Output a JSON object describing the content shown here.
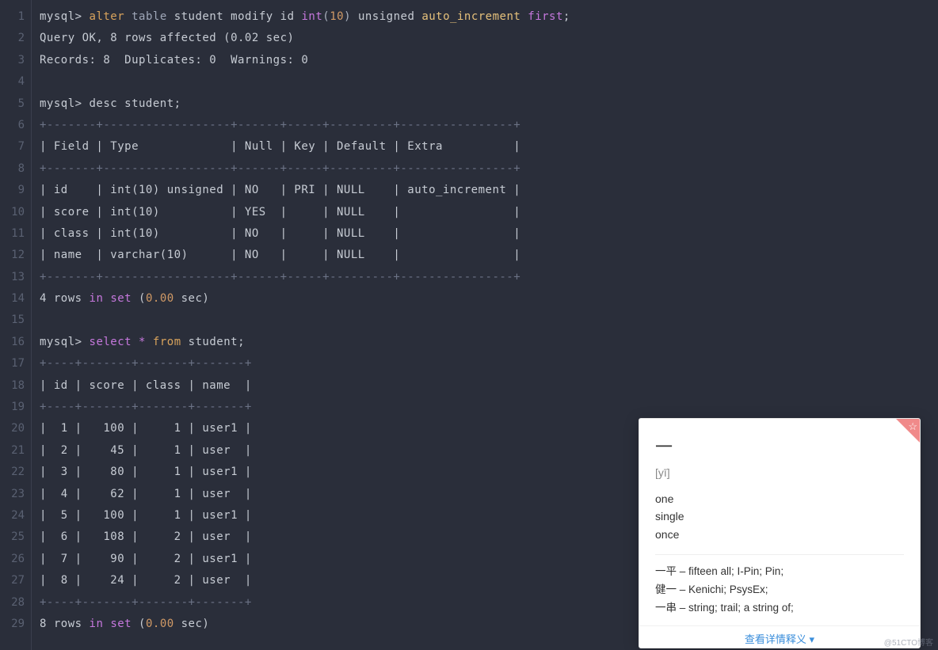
{
  "gutter": [
    "1",
    "2",
    "3",
    "4",
    "5",
    "6",
    "7",
    "8",
    "9",
    "10",
    "11",
    "12",
    "13",
    "14",
    "15",
    "16",
    "17",
    "18",
    "19",
    "20",
    "21",
    "22",
    "23",
    "24",
    "25",
    "26",
    "27",
    "28",
    "29"
  ],
  "sql": {
    "alter_prompt": "mysql> ",
    "alter_kw": "alter",
    "table_kw": "table",
    "student": "student",
    "modify": "modify",
    "id": "id",
    "int": "int",
    "ten": "10",
    "unsigned": "unsigned",
    "auto_inc": "auto_increment",
    "first": "first",
    "semi": ";",
    "query_ok": "Query OK, 8 rows affected (0.02 sec)",
    "records": "Records: 8  Duplicates: 0  Warnings: 0",
    "desc_prompt": "mysql> desc student;",
    "desc_border": "+-------+------------------+------+-----+---------+----------------+",
    "desc_header": "| Field | Type             | Null | Key | Default | Extra          |",
    "desc_rows": [
      "| id    | int(10) unsigned | NO   | PRI | NULL    | auto_increment |",
      "| score | int(10)          | YES  |     | NULL    |                |",
      "| class | int(10)          | NO   |     | NULL    |                |",
      "| name  | varchar(10)      | NO   |     | NULL    |                |"
    ],
    "rows4_a": "4 rows ",
    "rows4_in": "in",
    "rows4_set": "set",
    "rows4_b": " (",
    "rows4_time": "0.00",
    "rows4_c": " sec)",
    "select_prompt": "mysql> ",
    "select_kw": "select",
    "star_kw": "*",
    "from_kw": "from",
    "select_border": "+----+-------+-------+-------+",
    "select_header": "| id | score | class | name  |",
    "select_rows": [
      "|  1 |   100 |     1 | user1 |",
      "|  2 |    45 |     1 | user  |",
      "|  3 |    80 |     1 | user1 |",
      "|  4 |    62 |     1 | user  |",
      "|  5 |   100 |     1 | user1 |",
      "|  6 |   108 |     2 | user  |",
      "|  7 |    90 |     2 | user1 |",
      "|  8 |    24 |     2 | user  |"
    ],
    "rows8_a": "8 rows ",
    "rows8_in": "in",
    "rows8_set": "set",
    "rows8_b": " (",
    "rows8_time": "0.00",
    "rows8_c": " sec)"
  },
  "popup": {
    "word": "一",
    "pron": "[yī]",
    "defs": [
      "one",
      "single",
      "once"
    ],
    "examples": [
      "一平 – fifteen all; I-Pin; Pin;",
      "健一 – Kenichi; PsysEx;",
      "一串 – string; trail; a string of;"
    ],
    "more": "查看详情释义 ▾"
  },
  "watermark": "@51CTO博客"
}
